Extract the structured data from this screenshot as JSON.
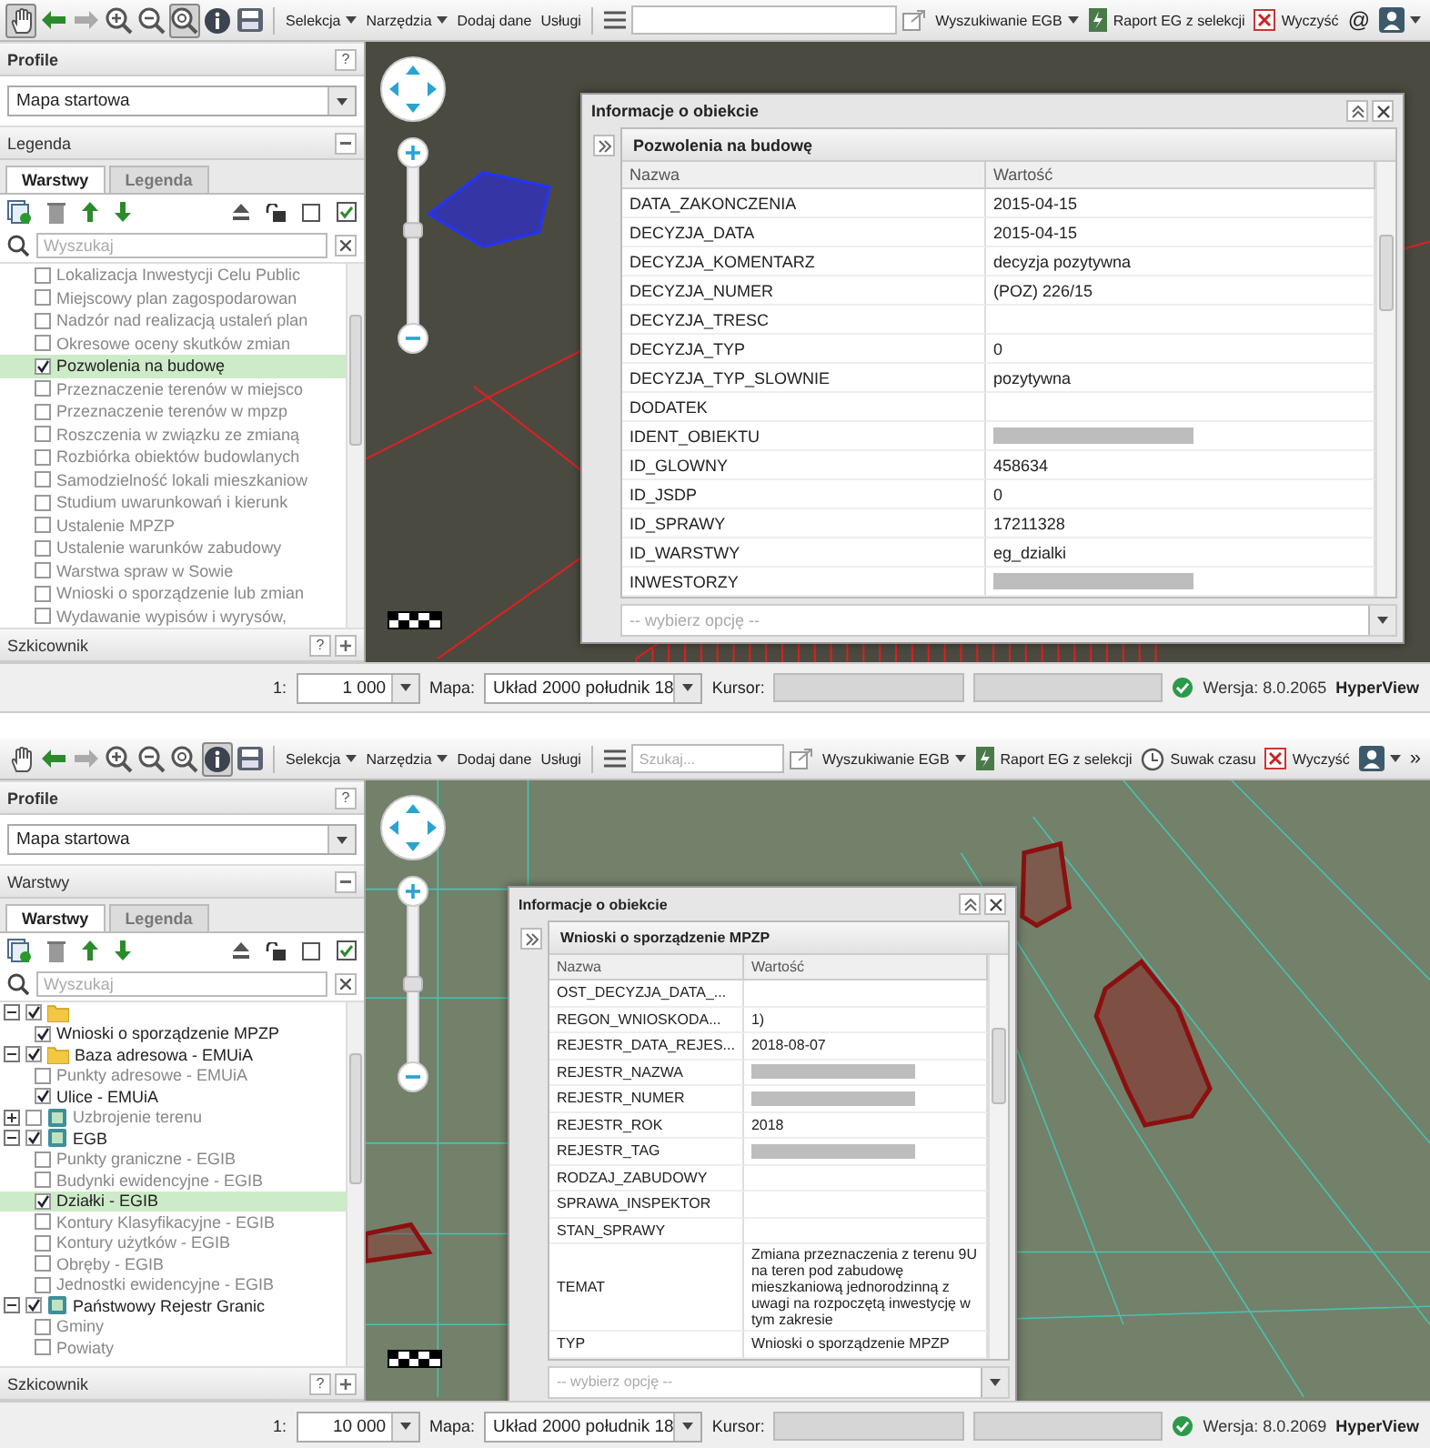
{
  "screens": [
    {
      "toolbar": {
        "tools": [
          {
            "kind": "pan",
            "selected": true
          },
          {
            "kind": "back",
            "selected": false
          },
          {
            "kind": "forward",
            "selected": false
          },
          {
            "kind": "zoom-in",
            "selected": false
          },
          {
            "kind": "zoom-out",
            "selected": false
          },
          {
            "kind": "zoom-extent",
            "selected": true
          },
          {
            "kind": "info",
            "selected": false
          },
          {
            "kind": "print",
            "selected": false
          }
        ],
        "menus": [
          {
            "label": "Selekcja",
            "dropdown": true
          },
          {
            "label": "Narzędzia",
            "dropdown": true
          },
          {
            "label": "Dodaj dane",
            "dropdown": false
          },
          {
            "label": "Usługi",
            "dropdown": false
          }
        ],
        "actions": [
          {
            "kind": "dropdown",
            "label": "Wyszukiwanie EGB"
          },
          {
            "kind": "report",
            "label": "Raport EG z selekcji"
          },
          {
            "kind": "clear",
            "label": "Wyczyść"
          },
          {
            "kind": "email",
            "label": "@"
          },
          {
            "kind": "user"
          }
        ]
      },
      "left": {
        "profile_title": "Profile",
        "profile_help": "?",
        "profile_value": "Mapa startowa",
        "panel_title": "Legenda",
        "tabs": [
          {
            "label": "Warstwy",
            "selected": true
          },
          {
            "label": "Legenda",
            "selected": false
          }
        ],
        "search_placeholder": "Wyszukaj",
        "layers": [
          {
            "kind": "layer",
            "label": "Lokalizacja Inwestycji Celu Public",
            "checked": false,
            "selected": false
          },
          {
            "kind": "layer",
            "label": "Miejscowy plan zagospodarowan",
            "checked": false,
            "selected": false
          },
          {
            "kind": "layer",
            "label": "Nadzór nad realizacją ustaleń plan",
            "checked": false,
            "selected": false
          },
          {
            "kind": "layer",
            "label": "Okresowe oceny skutków zmian",
            "checked": false,
            "selected": false
          },
          {
            "kind": "layer",
            "label": "Pozwolenia na budowę",
            "checked": true,
            "selected": true
          },
          {
            "kind": "layer",
            "label": "Przeznaczenie terenów w miejsco",
            "checked": false,
            "selected": false
          },
          {
            "kind": "layer",
            "label": "Przeznaczenie terenów w mpzp",
            "checked": false,
            "selected": false
          },
          {
            "kind": "layer",
            "label": "Roszczenia w związku ze zmianą",
            "checked": false,
            "selected": false
          },
          {
            "kind": "layer",
            "label": "Rozbiórka obiektów budowlanych",
            "checked": false,
            "selected": false
          },
          {
            "kind": "layer",
            "label": "Samodzielność lokali mieszkaniow",
            "checked": false,
            "selected": false
          },
          {
            "kind": "layer",
            "label": "Studium uwarunkowań i kierunk",
            "checked": false,
            "selected": false
          },
          {
            "kind": "layer",
            "label": "Ustalenie MPZP",
            "checked": false,
            "selected": false
          },
          {
            "kind": "layer",
            "label": "Ustalenie warunków zabudowy",
            "checked": false,
            "selected": false
          },
          {
            "kind": "layer",
            "label": "Warstwa spraw w Sowie",
            "checked": false,
            "selected": false
          },
          {
            "kind": "layer",
            "label": "Wnioski o sporządzenie lub zmian",
            "checked": false,
            "selected": false
          },
          {
            "kind": "layer",
            "label": "Wydawanie wypisów i wyrysów,",
            "checked": false,
            "selected": false
          }
        ],
        "sketch_title": "Szkicownik",
        "sketch_help": "?"
      },
      "map": {
        "kind": "urban",
        "zoom": {
          "level": 0.6
        }
      },
      "info": {
        "title": "Informacje o obiekcie",
        "layer": "Pozwolenia na budowę",
        "columns": [
          "Nazwa",
          "Wartość"
        ],
        "rows": [
          {
            "name": "DATA_ZAKONCZENIA",
            "value": "2015-04-15",
            "redacted": false
          },
          {
            "name": "DECYZJA_DATA",
            "value": "2015-04-15",
            "redacted": false
          },
          {
            "name": "DECYZJA_KOMENTARZ",
            "value": "decyzja pozytywna",
            "redacted": false
          },
          {
            "name": "DECYZJA_NUMER",
            "value": "(POZ) 226/15",
            "redacted": false
          },
          {
            "name": "DECYZJA_TRESC",
            "redacted": false
          },
          {
            "name": "DECYZJA_TYP",
            "value": "0",
            "redacted": false
          },
          {
            "name": "DECYZJA_TYP_SLOWNIE",
            "value": "pozytywna",
            "redacted": false
          },
          {
            "name": "DODATEK",
            "redacted": false
          },
          {
            "name": "IDENT_OBIEKTU",
            "redacted": true
          },
          {
            "name": "ID_GLOWNY",
            "value": "458634",
            "redacted": false
          },
          {
            "name": "ID_JSDP",
            "value": "0",
            "redacted": false
          },
          {
            "name": "ID_SPRAWY",
            "value": "17211328",
            "redacted": false
          },
          {
            "name": "ID_WARSTWY",
            "value": "eg_dzialki",
            "redacted": false
          },
          {
            "name": "INWESTORZY",
            "redacted": true
          }
        ],
        "select_placeholder": "-- wybierz opcję --"
      },
      "status": {
        "scale_label": "1:",
        "scale": "1 000",
        "map_label": "Mapa:",
        "map": "Układ 2000 południk 18",
        "cursor_label": "Kursor:",
        "version": "Wersja: 8.0.2065",
        "brand": "HyperView"
      }
    },
    {
      "toolbar": {
        "tools": [
          {
            "kind": "pan",
            "selected": false
          },
          {
            "kind": "back",
            "selected": false
          },
          {
            "kind": "forward",
            "selected": false
          },
          {
            "kind": "zoom-in",
            "selected": false
          },
          {
            "kind": "zoom-out",
            "selected": false
          },
          {
            "kind": "zoom-extent",
            "selected": false
          },
          {
            "kind": "info",
            "selected": true
          },
          {
            "kind": "print",
            "selected": false
          }
        ],
        "menus": [
          {
            "label": "Selekcja",
            "dropdown": true
          },
          {
            "label": "Narzędzia",
            "dropdown": true
          },
          {
            "label": "Dodaj dane",
            "dropdown": false
          },
          {
            "label": "Usługi",
            "dropdown": false
          }
        ],
        "search": {
          "placeholder": "Szukaj..."
        },
        "actions": [
          {
            "kind": "dropdown",
            "label": "Wyszukiwanie EGB"
          },
          {
            "kind": "report",
            "label": "Raport EG z selekcji"
          },
          {
            "kind": "timeslider",
            "label": "Suwak czasu"
          },
          {
            "kind": "clear",
            "label": "Wyczyść"
          },
          {
            "kind": "user"
          },
          {
            "kind": "more",
            "label": "»"
          }
        ]
      },
      "left": {
        "profile_title": "Profile",
        "profile_help": "?",
        "profile_value": "Mapa startowa",
        "panel_title": "Warstwy",
        "tabs": [
          {
            "label": "Warstwy",
            "selected": true
          },
          {
            "label": "Legenda",
            "selected": false
          }
        ],
        "search_placeholder": "Wyszukaj",
        "layers": [
          {
            "kind": "folder",
            "checked": true,
            "expanded": true,
            "selected": false,
            "children": [
              {
                "kind": "layer",
                "label": "Wnioski o sporządzenie MPZP",
                "checked": true,
                "selected": false
              }
            ]
          },
          {
            "kind": "folder",
            "label": "Baza adresowa - EMUiA",
            "checked": true,
            "expanded": true,
            "selected": false,
            "children": [
              {
                "kind": "layer",
                "label": "Punkty adresowe - EMUiA",
                "checked": false,
                "selected": false
              },
              {
                "kind": "layer",
                "label": "Ulice - EMUiA",
                "checked": true,
                "selected": false
              }
            ]
          },
          {
            "kind": "group",
            "label": "Uzbrojenie terenu",
            "checked": false,
            "expanded": false,
            "selected": false
          },
          {
            "kind": "group",
            "label": "EGB",
            "checked": true,
            "expanded": true,
            "selected": false,
            "children": [
              {
                "kind": "layer",
                "label": "Punkty graniczne - EGIB",
                "checked": false,
                "selected": false
              },
              {
                "kind": "layer",
                "label": "Budynki ewidencyjne - EGIB",
                "checked": false,
                "selected": false
              },
              {
                "kind": "layer",
                "label": "Działki - EGIB",
                "checked": true,
                "selected": true
              },
              {
                "kind": "layer",
                "label": "Kontury Klasyfikacyjne - EGIB",
                "checked": false,
                "selected": false
              },
              {
                "kind": "layer",
                "label": "Kontury użytków - EGIB",
                "checked": false,
                "selected": false
              },
              {
                "kind": "layer",
                "label": "Obręby - EGIB",
                "checked": false,
                "selected": false
              },
              {
                "kind": "layer",
                "label": "Jednostki ewidencyjne - EGIB",
                "checked": false,
                "selected": false
              }
            ]
          },
          {
            "kind": "group",
            "label": "Państwowy Rejestr Granic",
            "checked": true,
            "expanded": true,
            "selected": false,
            "children": [
              {
                "kind": "layer",
                "label": "Gminy",
                "checked": false,
                "selected": false
              },
              {
                "kind": "layer",
                "label": "Powiaty",
                "checked": false,
                "selected": false
              }
            ]
          }
        ],
        "sketch_title": "Szkicownik",
        "sketch_help": "?"
      },
      "map": {
        "kind": "overview",
        "zoom": {
          "level": 0.5
        }
      },
      "info": {
        "title": "Informacje o obiekcie",
        "layer": "Wnioski o sporządzenie MPZP",
        "columns": [
          "Nazwa",
          "Wartość"
        ],
        "rows": [
          {
            "name": "OST_DECYZJA_DATA_...",
            "redacted": false
          },
          {
            "name": "REGON_WNIOSKODA...",
            "value": "1)",
            "redacted": false
          },
          {
            "name": "REJESTR_DATA_REJES...",
            "value": "2018-08-07",
            "redacted": false
          },
          {
            "name": "REJESTR_NAZWA",
            "redacted": true
          },
          {
            "name": "REJESTR_NUMER",
            "redacted": true
          },
          {
            "name": "REJESTR_ROK",
            "value": "2018",
            "redacted": false
          },
          {
            "name": "REJESTR_TAG",
            "redacted": true
          },
          {
            "name": "RODZAJ_ZABUDOWY",
            "redacted": false
          },
          {
            "name": "SPRAWA_INSPEKTOR",
            "redacted": false
          },
          {
            "name": "STAN_SPRAWY",
            "redacted": false
          },
          {
            "name": "TEMAT",
            "value": "Zmiana przeznaczenia z terenu 9U na teren pod zabudowę mieszkaniową jednorodzinną z uwagi na rozpoczętą inwestycję w tym zakresie",
            "redacted": false
          },
          {
            "name": "TYP",
            "value": "Wnioski o sporządzenie MPZP",
            "redacted": false
          }
        ],
        "select_placeholder": "-- wybierz opcję --"
      },
      "status": {
        "scale_label": "1:",
        "scale": "10 000",
        "map_label": "Mapa:",
        "map": "Układ 2000 południk 18",
        "cursor_label": "Kursor:",
        "version": "Wersja: 8.0.2069",
        "brand": "HyperView"
      }
    }
  ]
}
